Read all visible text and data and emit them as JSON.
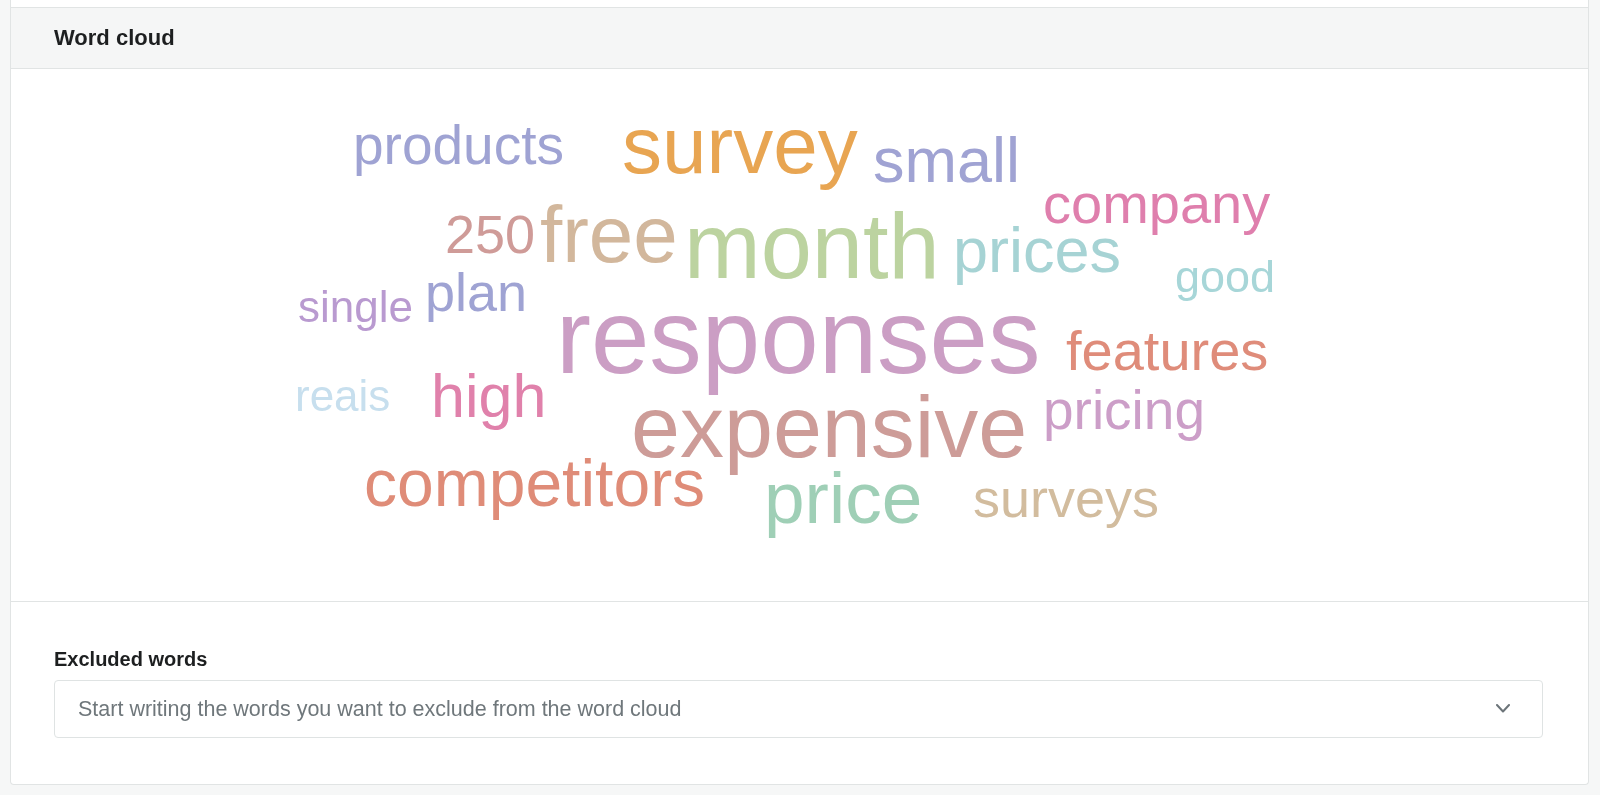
{
  "panel": {
    "title": "Word cloud"
  },
  "word_cloud": {
    "words": [
      {
        "text": "products",
        "color": "#9fa3d3"
      },
      {
        "text": "survey",
        "color": "#e8a552"
      },
      {
        "text": "small",
        "color": "#a0a3d3"
      },
      {
        "text": "company",
        "color": "#df7fad"
      },
      {
        "text": "250",
        "color": "#cf9b98"
      },
      {
        "text": "free",
        "color": "#d2b79c"
      },
      {
        "text": "month",
        "color": "#bcd3a0"
      },
      {
        "text": "prices",
        "color": "#a6d3d4"
      },
      {
        "text": "good",
        "color": "#a7d6d8"
      },
      {
        "text": "single",
        "color": "#b99ad0"
      },
      {
        "text": "plan",
        "color": "#9fa3d3"
      },
      {
        "text": "responses",
        "color": "#cb9ec4"
      },
      {
        "text": "features",
        "color": "#df8c7a"
      },
      {
        "text": "reais",
        "color": "#c7dfee"
      },
      {
        "text": "high",
        "color": "#e081ab"
      },
      {
        "text": "expensive",
        "color": "#cd9c98"
      },
      {
        "text": "pricing",
        "color": "#cc9ec8"
      },
      {
        "text": "competitors",
        "color": "#df8c78"
      },
      {
        "text": "price",
        "color": "#9fcfb6"
      },
      {
        "text": "surveys",
        "color": "#d2bc9e"
      }
    ]
  },
  "excluded_words": {
    "label": "Excluded words",
    "placeholder": "Start writing the words you want to exclude from the word cloud"
  }
}
